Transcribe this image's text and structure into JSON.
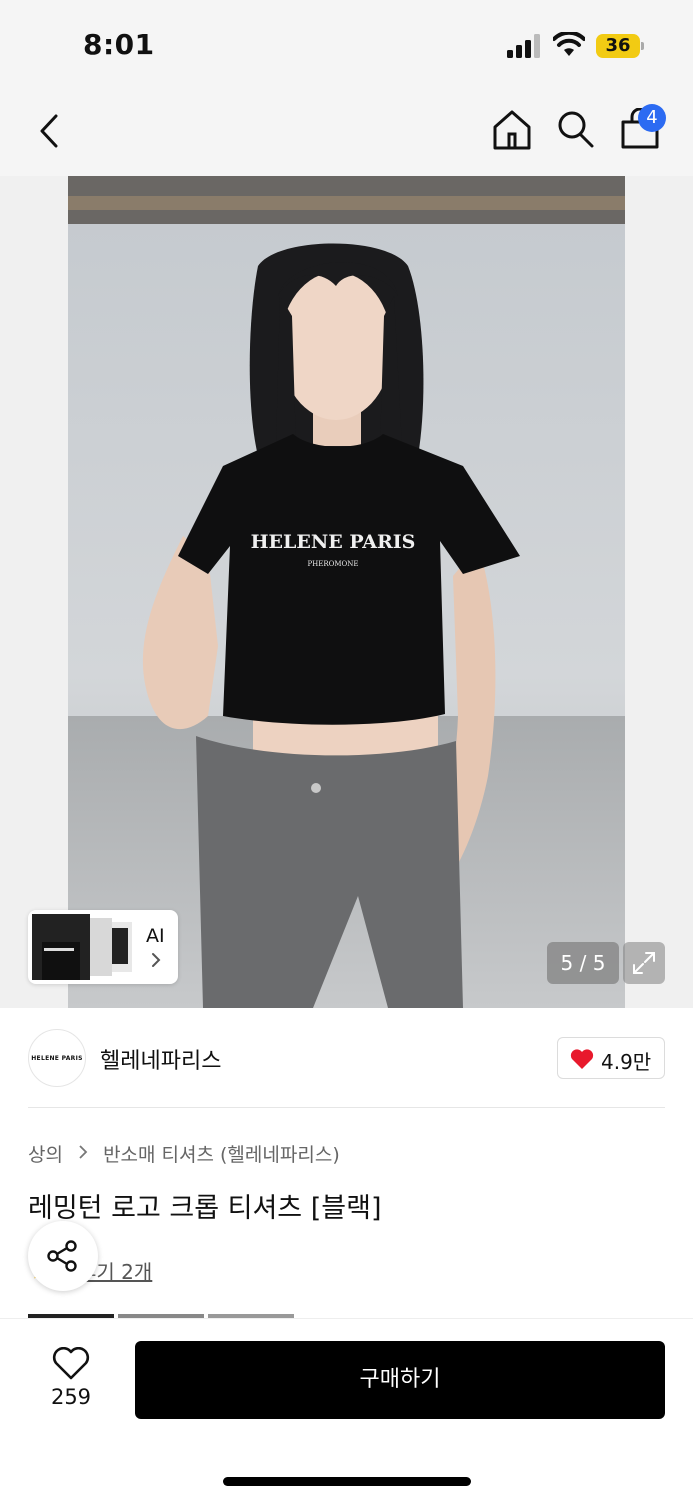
{
  "status_bar": {
    "time": "8:01",
    "battery": "36"
  },
  "nav": {
    "back": "chevron-left-icon",
    "home": "home-icon",
    "search": "search-icon",
    "cart": "shopping-bag-icon",
    "cart_badge": "4"
  },
  "gallery": {
    "ai_label": "AI",
    "counter": "5 / 5",
    "expand": "expand-icon",
    "shirt_text": "HELENE PARIS",
    "shirt_subtext": "PHEROMONE"
  },
  "brand": {
    "logo_text": "HELENE PARIS",
    "name": "헬레네파리스",
    "likes": "4.9만"
  },
  "product": {
    "breadcrumb": [
      "상의",
      "반소매 티셔츠 (헬레네파리스)"
    ],
    "title": "레밍턴 로고 크롭 티셔츠 [블랙]",
    "review_link": "후기 2개"
  },
  "bottom_bar": {
    "wish_count": "259",
    "buy_label": "구매하기"
  },
  "colors": {
    "accent_blue": "#2c6bf2",
    "heart_red": "#e8192c",
    "battery_yellow": "#f2cb13",
    "buy_button": "#000000"
  }
}
